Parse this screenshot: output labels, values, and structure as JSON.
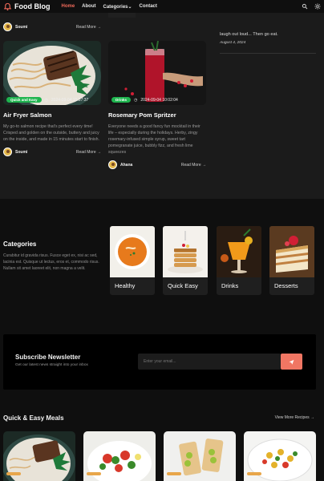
{
  "nav": {
    "brand": "Food Blog",
    "links": [
      "Home",
      "About",
      "Categories",
      "Contact"
    ],
    "categories_caret": "⌄",
    "colors": {
      "accent": "#f06a5a"
    }
  },
  "posts": {
    "top_left_author": "Soumi",
    "top_left_read": "Read More →",
    "cards": [
      {
        "tag": "Quick and Easy",
        "date": "2024-09-04 15:37:37",
        "title": "Air Fryer Salmon",
        "desc": "My go-to salmon recipe that's perfect every time! Crisped and golden on the outside, buttery and juicy on the inside, and made in 15 minutes start to finish.",
        "author": "Soumi",
        "read": "Read More →"
      },
      {
        "tag": "Drinks",
        "date": "2024-09-04 10:02:04",
        "title": "Rosemary Pom Spritzer",
        "desc": "Everyone needs a good fancy fun mocktail in their life – especially during the holidays. Herby, zingy rosemary-infused simple syrup, sweet tart pomegranate juice, bubbly fizz, and fresh lime squeezes",
        "author": "Ahana",
        "read": "Read More →"
      }
    ]
  },
  "sidebar": {
    "quote_tail": "laugh out loud... Then go eat.",
    "date": "August 4, 2024"
  },
  "categories": {
    "heading": "Categories",
    "desc": "Curabitur id gravida risus. Fusce eget ex, nisi ac sed, lacinia est. Quisque ut lectus, eros et, commodo risus. Nullam sit amet laoreet elit, non magna a velit.",
    "items": [
      "Healthy",
      "Quick Easy",
      "Drinks",
      "Desserts"
    ]
  },
  "newsletter": {
    "title": "Subscribe Newsletter",
    "subtitle": "Get our latest news straight into your inbox",
    "placeholder": "Enter your email..."
  },
  "quick_easy": {
    "heading": "Quick & Easy Meals",
    "more": "View More Recipes →"
  }
}
